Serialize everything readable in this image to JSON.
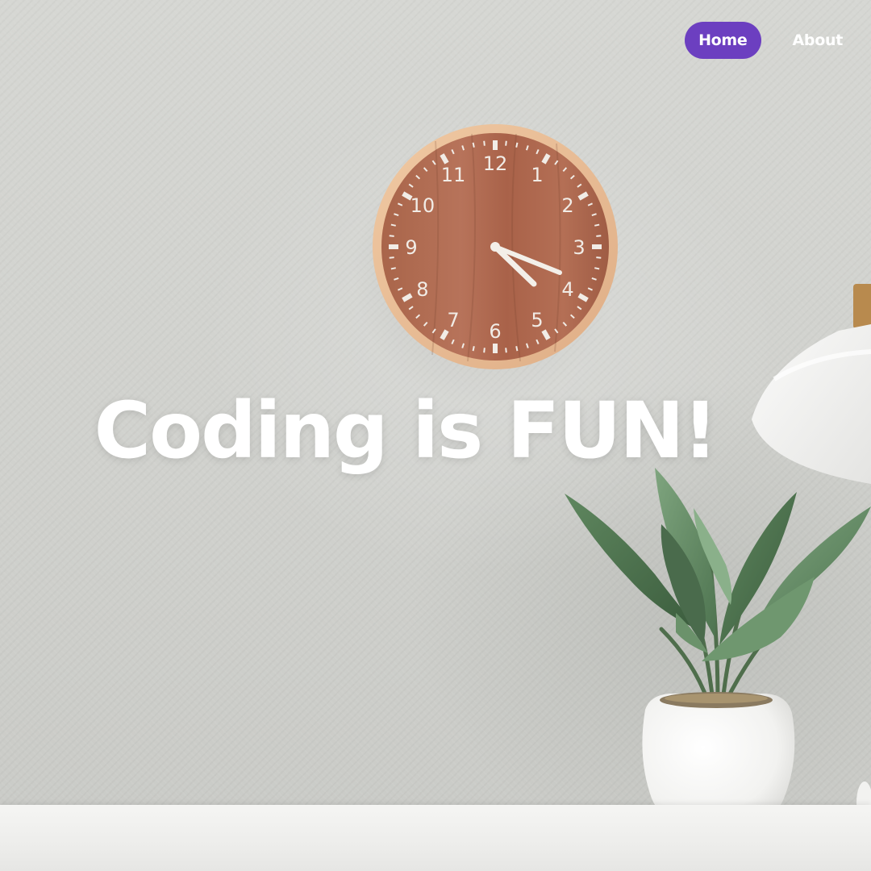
{
  "nav": {
    "items": [
      {
        "label": "Home",
        "active": true
      },
      {
        "label": "About",
        "active": false
      }
    ]
  },
  "hero": {
    "headline": "Coding is FUN!"
  },
  "clock": {
    "numerals": [
      "12",
      "1",
      "2",
      "3",
      "4",
      "5",
      "6",
      "7",
      "8",
      "9",
      "10",
      "11"
    ]
  },
  "colors": {
    "accent": "#6c3fc0",
    "wall": "#d3d4d0",
    "text": "#ffffff"
  }
}
